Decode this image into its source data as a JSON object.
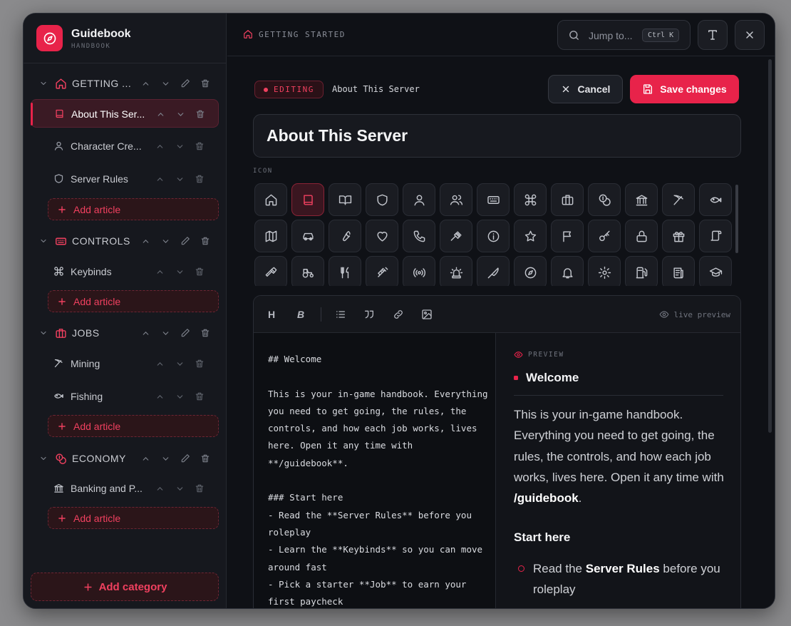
{
  "brand": {
    "title": "Guidebook",
    "subtitle": "HANDBOOK"
  },
  "sidebar": {
    "categories": [
      {
        "label": "GETTING ...",
        "icon": "home-icon",
        "articles": [
          {
            "label": "About This Ser...",
            "icon": "book-icon",
            "active": true
          },
          {
            "label": "Character Cre...",
            "icon": "user-icon"
          },
          {
            "label": "Server Rules",
            "icon": "shield-icon"
          }
        ],
        "add_label": "Add article"
      },
      {
        "label": "CONTROLS",
        "icon": "keyboard-icon",
        "articles": [
          {
            "label": "Keybinds",
            "icon": "command-icon"
          }
        ],
        "add_label": "Add article"
      },
      {
        "label": "JOBS",
        "icon": "briefcase-icon",
        "articles": [
          {
            "label": "Mining",
            "icon": "pickaxe-icon"
          },
          {
            "label": "Fishing",
            "icon": "fish-icon"
          }
        ],
        "add_label": "Add article"
      },
      {
        "label": "ECONOMY",
        "icon": "coins-icon",
        "articles": [
          {
            "label": "Banking and P...",
            "icon": "bank-icon"
          }
        ],
        "add_label": "Add article"
      }
    ],
    "add_category_label": "Add category"
  },
  "topbar": {
    "breadcrumb": "GETTING STARTED",
    "search_label": "Jump to...",
    "search_shortcut": "Ctrl K"
  },
  "editor_header": {
    "status": "EDITING",
    "article_title": "About This Server",
    "cancel_label": "Cancel",
    "save_label": "Save changes"
  },
  "title_field": {
    "value": "About This Server"
  },
  "icon_picker": {
    "label": "ICON",
    "selected": "book-icon",
    "icons": [
      "home-icon",
      "book-icon",
      "book-open-icon",
      "shield-icon",
      "user-icon",
      "users-icon",
      "keyboard-icon",
      "command-icon",
      "briefcase-icon",
      "coins-icon",
      "bank-icon",
      "pickaxe-icon",
      "fish-icon",
      "map-icon",
      "car-icon",
      "wrench-icon",
      "heart-icon",
      "phone-icon",
      "gavel-icon",
      "info-icon",
      "star-icon",
      "flag-icon",
      "key-icon",
      "lock-icon",
      "gift-icon",
      "scroll-icon",
      "hammer-icon",
      "tractor-icon",
      "utensils-icon",
      "syringe-icon",
      "radio-icon",
      "siren-icon",
      "knife-icon",
      "compass-icon",
      "bell-icon",
      "gear-icon",
      "fuel-icon",
      "newspaper-icon",
      "graduation-cap-icon"
    ]
  },
  "toolbar": {
    "heading_label": "H",
    "bold_label": "B",
    "live_preview_label": "live preview"
  },
  "source": {
    "markdown": "## Welcome\n\nThis is your in-game handbook. Everything you need to get going, the rules, the controls, and how each job works, lives here. Open it any time with **/guidebook**.\n\n### Start here\n- Read the **Server Rules** before you roleplay\n- Learn the **Keybinds** so you can move around fast\n- Pick a starter **Job** to earn your first paycheck"
  },
  "preview": {
    "label": "PREVIEW",
    "h2": "Welcome",
    "p_before": "This is your in-game handbook. Everything you need to get going, the rules, the controls, and how each job works, lives here. Open it any time with ",
    "p_bold": "/guidebook",
    "p_after": ".",
    "h3": "Start here",
    "li1_before": "Read the ",
    "li1_bold": "Server Rules",
    "li1_after": " before you roleplay"
  },
  "colors": {
    "accent": "#e8234a",
    "background": "#0f1116",
    "sidebar": "#16181e"
  }
}
